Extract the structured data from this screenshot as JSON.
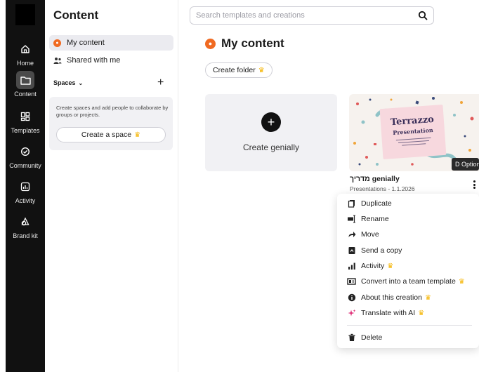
{
  "rail": {
    "items": [
      {
        "label": "Home",
        "icon": "home-icon"
      },
      {
        "label": "Content",
        "icon": "folder-icon"
      },
      {
        "label": "Templates",
        "icon": "templates-icon"
      },
      {
        "label": "Community",
        "icon": "community-icon"
      },
      {
        "label": "Activity",
        "icon": "activity-icon"
      },
      {
        "label": "Brand kit",
        "icon": "brand-kit-icon"
      }
    ],
    "active": "Content"
  },
  "sidebar": {
    "title": "Content",
    "my_content": "My content",
    "shared_with_me": "Shared with me",
    "spaces_label": "Spaces",
    "spaces_text": "Create spaces and add people to collaborate by groups or projects.",
    "create_space": "Create a space"
  },
  "search": {
    "placeholder": "Search templates and creations"
  },
  "main": {
    "title": "My content",
    "create_folder": "Create folder",
    "create_genially": "Create genially",
    "item": {
      "thumb_title": "Terrazzo",
      "thumb_subtitle": "Presentation",
      "name": "מדריך genially",
      "meta": "Presentations - 1.1.2026",
      "tooltip": "Options",
      "tooltip_badge": "D"
    }
  },
  "menu": {
    "items": [
      {
        "label": "Duplicate",
        "icon": "duplicate-icon",
        "premium": false
      },
      {
        "label": "Rename",
        "icon": "rename-icon",
        "premium": false
      },
      {
        "label": "Move",
        "icon": "move-icon",
        "premium": false
      },
      {
        "label": "Send a copy",
        "icon": "send-icon",
        "premium": false
      },
      {
        "label": "Activity",
        "icon": "activity-icon",
        "premium": true
      },
      {
        "label": "Convert into a team template",
        "icon": "template-icon",
        "premium": true
      },
      {
        "label": "About this creation",
        "icon": "info-icon",
        "premium": true
      },
      {
        "label": "Translate with AI",
        "icon": "ai-sparkle-icon",
        "premium": true
      },
      {
        "label": "Delete",
        "icon": "trash-icon",
        "premium": false
      }
    ]
  },
  "colors": {
    "accent": "#f06a21",
    "crown": "#f5b400",
    "rail": "#111111",
    "ai": "#e0337a"
  }
}
